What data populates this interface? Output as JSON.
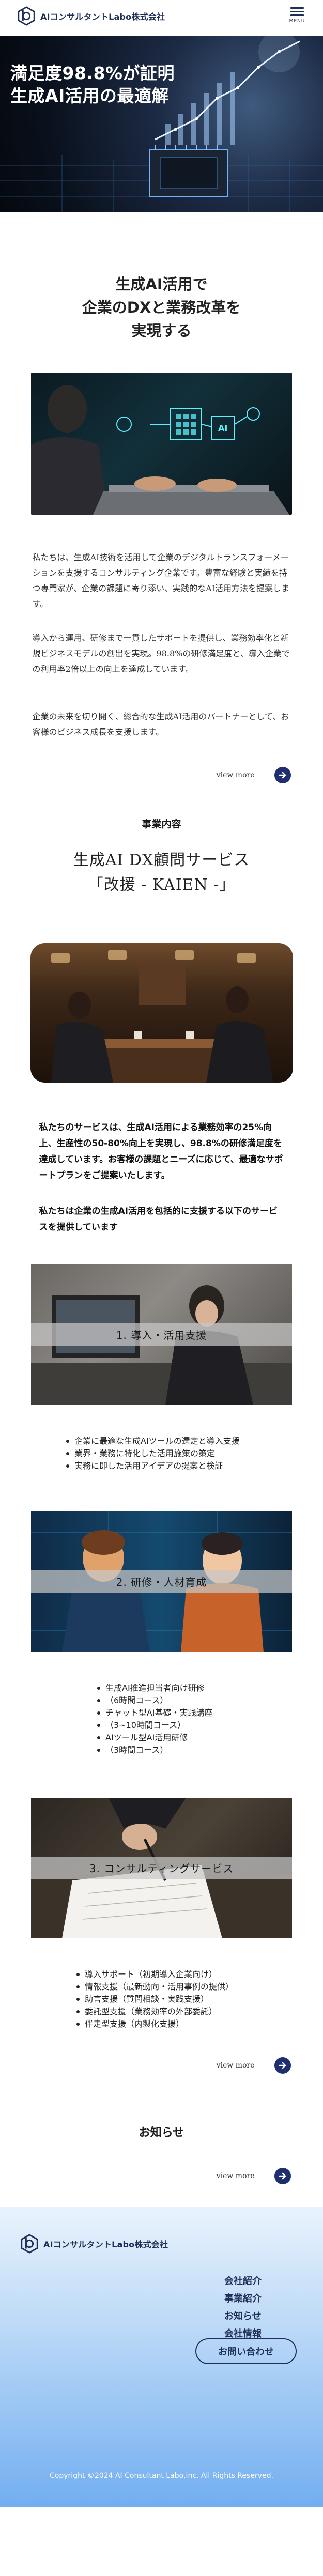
{
  "header": {
    "logo_text": "AIコンサルタントLabo株式会社",
    "menu_label": "MENU"
  },
  "hero": {
    "title_line1": "満足度98.8%が証明",
    "title_line2": "生成AI活用の最適解"
  },
  "intro": {
    "heading_line1": "生成AI活用で",
    "heading_line2": "企業のDXと業務改革を",
    "heading_line3": "実現する",
    "image_chip_label": "AI",
    "paragraph1": "私たちは、生成AI技術を活用して企業のデジタルトランスフォーメーションを支援するコンサルティング企業です。豊富な経験と実績を持つ専門家が、企業の課題に寄り添い、実践的なAI活用方法を提案します。",
    "paragraph2": "導入から運用、研修まで一貫したサポートを提供し、業務効率化と新規ビジネスモデルの創出を実現。98.8%の研修満足度と、導入企業での利用率2倍以上の向上を達成しています。",
    "paragraph3": "企業の未来を切り開く、総合的な生成AI活用のパートナーとして、お客様のビジネス成長を支援します。",
    "view_more": "view more"
  },
  "services": {
    "heading": "事業内容",
    "title_line1": "生成AI DX顧問サービス",
    "title_line2": "「改援 - KAIEN -」",
    "description": "私たちのサービスは、生成AI活用による業務効率の25%向上、生産性の50-80%向上を実現し、98.8%の研修満足度を達成しています。お客様の課題とニーズに応じて、最適なサポートプランをご提案いたします。",
    "description2": "私たちは企業の生成AI活用を包括的に支援する以下のサービスを提供しています",
    "items": [
      {
        "caption": "1. 導入・活用支援",
        "bullets": [
          "企業に最適な生成AIツールの選定と導入支援",
          "業界・業務に特化した活用施策の策定",
          "実務に即した活用アイデアの提案と検証"
        ]
      },
      {
        "caption": "2. 研修・人材育成",
        "bullets": [
          "生成AI推進担当者向け研修",
          "（6時間コース）",
          "チャット型AI基礎・実践講座",
          "（3~10時間コース）",
          "AIツール型AI活用研修",
          "（3時間コース）"
        ]
      },
      {
        "caption": "3. コンサルティングサービス",
        "bullets": [
          "導入サポート（初期導入企業向け）",
          "情報支援（最新動向・活用事例の提供）",
          "助言支援（質問相談・実践支援）",
          "委託型支援（業務効率の外部委託）",
          "伴走型支援（内製化支援）"
        ]
      }
    ],
    "view_more": "view more"
  },
  "news": {
    "heading": "お知らせ",
    "view_more": "view more"
  },
  "footer": {
    "logo_text": "AIコンサルタントLabo株式会社",
    "nav": [
      "会社紹介",
      "事業紹介",
      "お知らせ",
      "会社情報"
    ],
    "contact_button": "お問い合わせ",
    "copyright": "Copyright ©2024 AI Consultant Labo,inc. All Rights Reserved."
  },
  "colors": {
    "brand_navy": "#1f2e56",
    "accent_blue": "#1f2e6e",
    "footer_gradient_top": "#e9f3fd",
    "footer_gradient_bottom": "#72aef0"
  },
  "icons": {
    "logo": "hexagon-logo-icon",
    "menu": "hamburger-menu-icon",
    "arrow": "arrow-right-icon"
  }
}
